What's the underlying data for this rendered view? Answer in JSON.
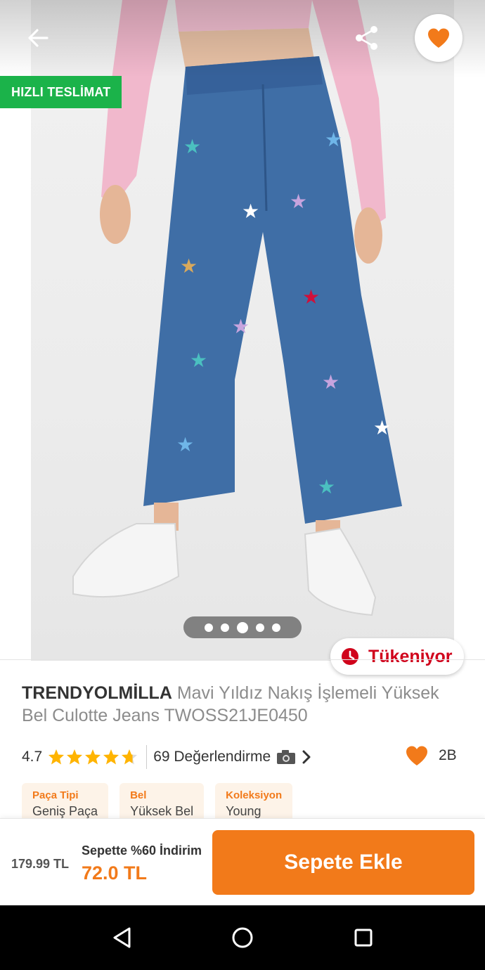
{
  "header": {
    "back_icon": "arrow-left-icon",
    "share_icon": "share-icon",
    "favorite_icon": "heart-icon",
    "fast_delivery_badge": "HIZLI TESLİMAT"
  },
  "gallery": {
    "image_description_icon": "product-photo",
    "dots_total": 5,
    "active_dot": 3,
    "stock_badge": "Tükeniyor"
  },
  "product": {
    "brand": "TRENDYOLMİLLA",
    "name": "Mavi Yıldız Nakış İşlemeli Yüksek Bel Culotte Jeans TWOSS21JE0450",
    "rating": "4.7",
    "rating_value": 4.7,
    "reviews": "69 Değerlendirme",
    "favorites": "2B"
  },
  "attributes": [
    {
      "key": "Paça Tipi",
      "value": "Geniş Paça"
    },
    {
      "key": "Bel",
      "value": "Yüksek Bel"
    },
    {
      "key": "Koleksiyon",
      "value": "Young"
    }
  ],
  "bottom_bar": {
    "old_price": "179.99 TL",
    "cart_note": "Sepette %60 İndirim",
    "new_price": "72.0 TL",
    "add_to_cart": "Sepete Ekle"
  },
  "colors": {
    "accent": "#f27a1a",
    "badge_green": "#1bb34a",
    "alert_red": "#d0021b",
    "star_yellow": "#ffb400"
  }
}
